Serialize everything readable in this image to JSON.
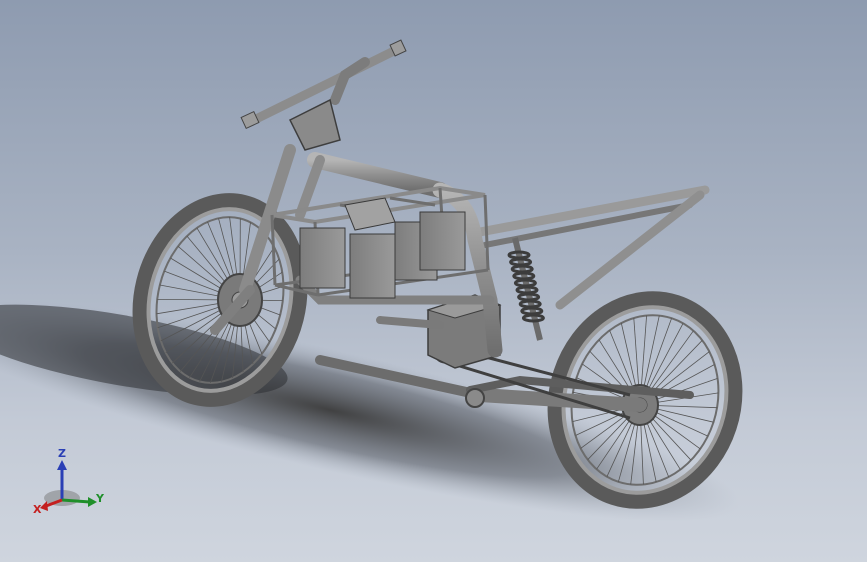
{
  "viewport": {
    "background_top": "#8e9bb0",
    "background_bottom": "#cfd5de",
    "model_color": "#8f8f8f"
  },
  "triad": {
    "z_label": "Z",
    "x_label": "X",
    "y_label": "Y",
    "z_color": "#2a3fb5",
    "x_color": "#c42020",
    "y_color": "#1f8f2a"
  }
}
